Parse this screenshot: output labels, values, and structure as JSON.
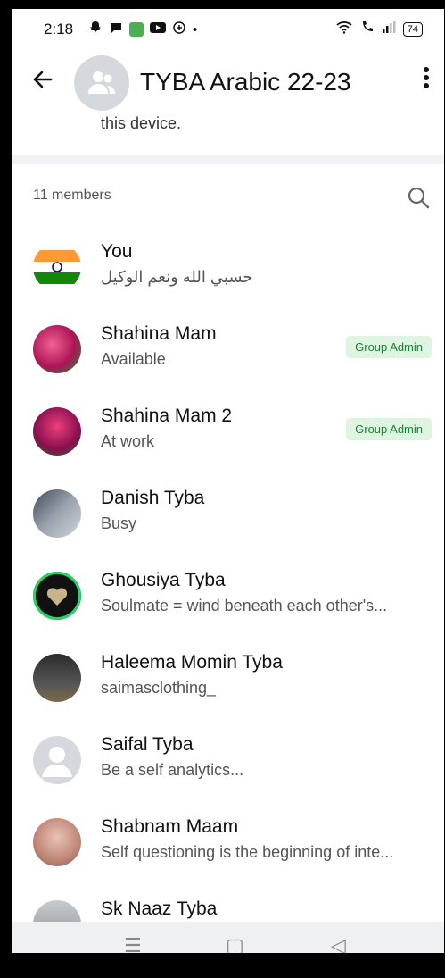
{
  "status_bar": {
    "time": "2:18",
    "dot": "•",
    "battery": "74",
    "icons": [
      "snapchat-icon",
      "chat-icon",
      "green-app-icon",
      "youtube-icon",
      "vpn-icon",
      "wifi-icon",
      "wifi-call-icon",
      "signal-icon"
    ]
  },
  "header": {
    "back_icon": "arrow-left-icon",
    "title": "TYBA Arabic 22-23",
    "menu_icon": "more-vertical-icon"
  },
  "description_tail": "this device.",
  "members_section": {
    "count_label": "11 members",
    "search_icon": "search-icon"
  },
  "members": [
    {
      "name": "You",
      "status": "حسبي الله ونعم الوكيل",
      "admin": ""
    },
    {
      "name": "Shahina Mam",
      "status": "Available",
      "admin": "Group Admin"
    },
    {
      "name": "Shahina Mam 2",
      "status": "At work",
      "admin": "Group Admin"
    },
    {
      "name": "Danish Tyba",
      "status": "Busy",
      "admin": ""
    },
    {
      "name": "Ghousiya Tyba",
      "status": "Soulmate = wind beneath each other's...",
      "admin": ""
    },
    {
      "name": "Haleema Momin Tyba",
      "status": "saimasclothing_",
      "admin": ""
    },
    {
      "name": "Saifal Tyba",
      "status": "Be a self analytics...",
      "admin": ""
    },
    {
      "name": "Shabnam Maam",
      "status": "Self questioning is the beginning of inte...",
      "admin": ""
    },
    {
      "name": "Sk Naaz Tyba",
      "status": "",
      "admin": ""
    }
  ],
  "nav_bar": {
    "menu_glyph": "☰",
    "home_glyph": "▢",
    "back_glyph": "◁"
  },
  "colors": {
    "admin_badge_bg": "#dff5e1",
    "admin_badge_text": "#1a7f37",
    "status_ring": "#25d366"
  }
}
